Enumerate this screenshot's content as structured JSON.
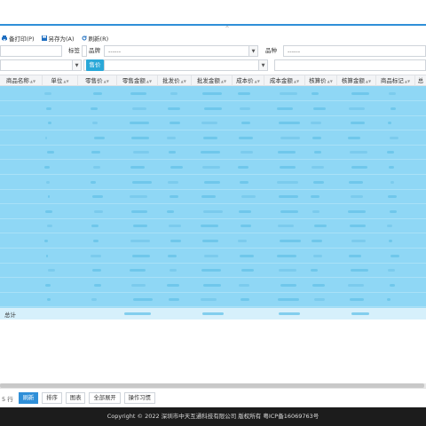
{
  "collapse_arrow": "^",
  "toolbar": {
    "items": [
      {
        "icon": "print-icon",
        "label": "备打印(P)"
      },
      {
        "icon": "save-icon",
        "label": "另存为(A)"
      },
      {
        "icon": "refresh-icon",
        "label": "刷新(R)"
      }
    ]
  },
  "filters": {
    "tag_label": "标签",
    "brand_label": "品牌",
    "brand_value": "------",
    "category_label": "品种",
    "category_value": "------",
    "price_button": "售价"
  },
  "table": {
    "columns": [
      "商品名称",
      "单位",
      "零售价",
      "零售金额",
      "批发价",
      "批发金额",
      "成本价",
      "成本金额",
      "核算价",
      "核算金额",
      "商品标记",
      "总"
    ],
    "footer_label": "总计"
  },
  "bottom": {
    "row_count": "5 行",
    "buttons": [
      "刷新",
      "排序",
      "图表",
      "全部展开",
      "操作习惯"
    ]
  },
  "copyright": "Copyright © 2022 深圳市中天互通科技有限公司 版权所有 粤ICP备16069763号",
  "colors": {
    "accent": "#2f8fd8",
    "selection": "#8fd7f5",
    "price_button": "#2aa8d8",
    "footer_bg": "#1c1c1c"
  }
}
